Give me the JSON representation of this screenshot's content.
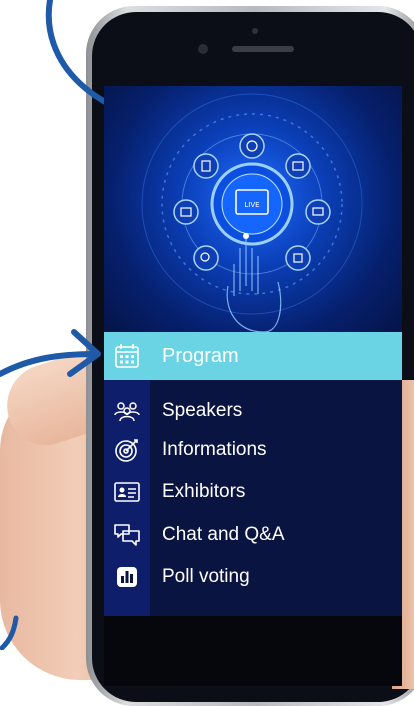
{
  "menu": {
    "items": [
      {
        "label": "Program",
        "icon": "calendar-icon",
        "active": true
      },
      {
        "label": "Speakers",
        "icon": "people-icon"
      },
      {
        "label": "Informations",
        "icon": "target-icon"
      },
      {
        "label": "Exhibitors",
        "icon": "id-card-icon"
      },
      {
        "label": "Chat and Q&A",
        "icon": "chat-icon"
      },
      {
        "label": "Poll voting",
        "icon": "bar-chart-icon"
      }
    ]
  },
  "hero": {
    "center_badge": "LIVE"
  },
  "colors": {
    "highlight": "#6ad3e4",
    "menu_bg": "#0a1440",
    "sidebar": "#0f1e6b",
    "arrow": "#1e5aa8"
  }
}
